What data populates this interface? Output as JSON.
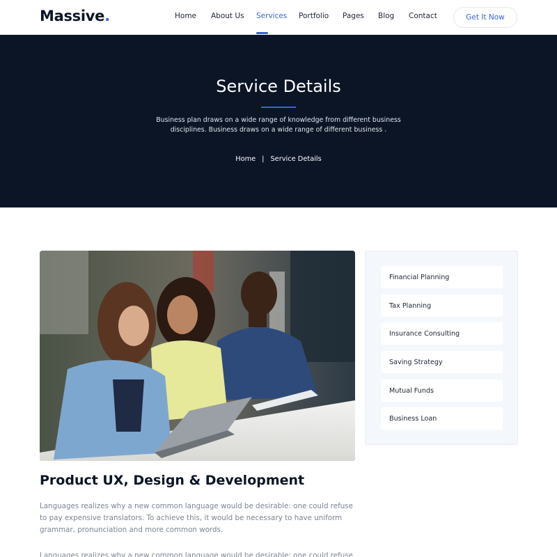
{
  "header": {
    "logo": "Massive",
    "logo_dot": ".",
    "nav": [
      "Home",
      "About Us",
      "Services",
      "Portfolio",
      "Pages",
      "Blog",
      "Contact"
    ],
    "active_nav": "Services",
    "cta_label": "Get It Now"
  },
  "hero": {
    "title": "Service Details",
    "description_line1": "Business plan draws on a wide range of knowledge from different business",
    "description_line2": "disciplines. Business draws on a wide range of different business .",
    "breadcrumb": {
      "home": "Home",
      "separator": "|",
      "current": "Service Details"
    }
  },
  "main": {
    "image_alt": "Three colleagues looking at a laptop",
    "title": "Product UX, Design & Development",
    "paragraphs": [
      "Languages realizes why a new common language would be desirable: one could refuse to pay expensive translators. To achieve this, it would be necessary to have uniform grammar, pronunciation and more common words.",
      "Languages realizes why a new common language would be desirable: one could refuse to"
    ]
  },
  "sidebar": {
    "items": [
      "Financial Planning",
      "Tax Planning",
      "Insurance Consulting",
      "Saving Strategy",
      "Mutual Funds",
      "Business Loan"
    ]
  },
  "colors": {
    "accent": "#3b63d6",
    "hero_bg": "#0b1526",
    "text_dark": "#0b1526",
    "text_muted": "#7c8594",
    "sidebar_bg": "#f4f7fb"
  }
}
